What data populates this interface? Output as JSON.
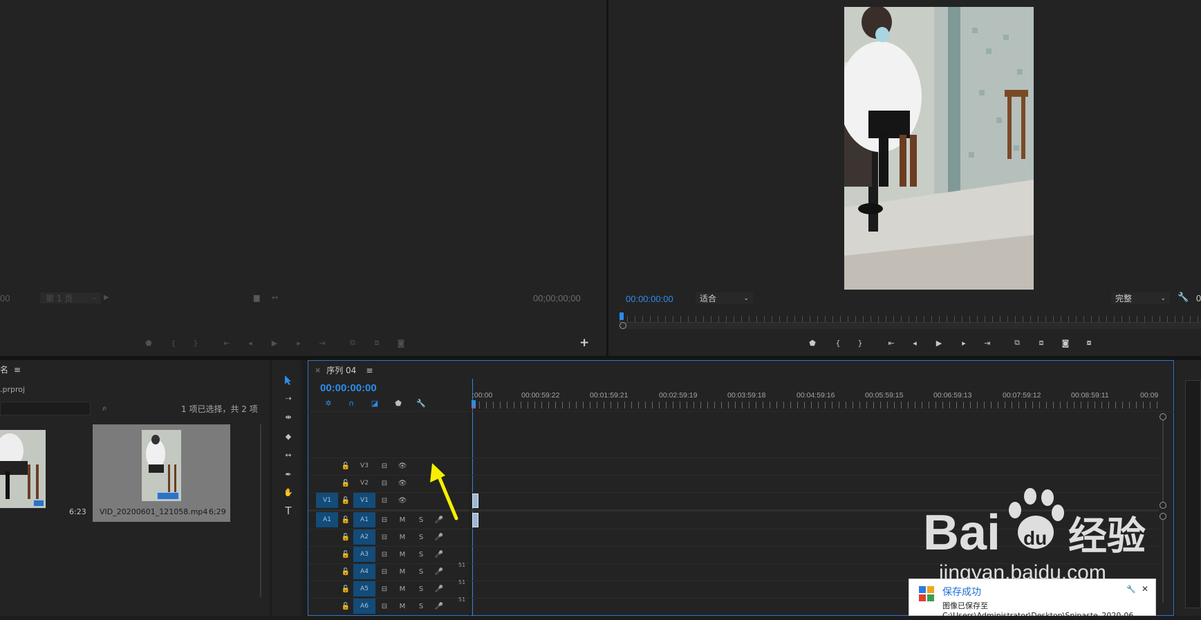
{
  "source_monitor": {
    "timecode_left": "00",
    "page_select": "第 1 页",
    "timecode_right": "00;00;00;00",
    "add_label": "+"
  },
  "program_monitor": {
    "timecode": "00:00:00:00",
    "fit_select": "适合",
    "quality_select": "完整",
    "right_cut": "0"
  },
  "project_panel": {
    "tab_fragment": "名",
    "tab_menu": "≡",
    "project_file": ".prproj",
    "selection_status": "1 项已选择，共 2 项",
    "items": [
      {
        "name": "",
        "duration": "6:23"
      },
      {
        "name": "VID_20200601_121058.mp4",
        "duration": "6;29"
      }
    ]
  },
  "timeline": {
    "close": "×",
    "sequence_tab": "序列 04",
    "menu": "≡",
    "timecode": "00:00:00:00",
    "ruler": [
      ":00:00",
      "00:00:59:22",
      "00:01:59:21",
      "00:02:59:19",
      "00:03:59:18",
      "00:04:59:16",
      "00:05:59:15",
      "00:06:59:13",
      "00:07:59:12",
      "00:08:59:11",
      "00:09"
    ],
    "video_tracks": [
      {
        "target": "",
        "name": "V3"
      },
      {
        "target": "",
        "name": "V2"
      },
      {
        "target": "V1",
        "name": "V1"
      }
    ],
    "audio_tracks": [
      {
        "target": "A1",
        "name": "A1",
        "m": "M",
        "s": "S",
        "extra": ""
      },
      {
        "target": "",
        "name": "A2",
        "m": "M",
        "s": "S",
        "extra": ""
      },
      {
        "target": "",
        "name": "A3",
        "m": "M",
        "s": "S",
        "extra": ""
      },
      {
        "target": "",
        "name": "A4",
        "m": "M",
        "s": "S",
        "extra": "51"
      },
      {
        "target": "",
        "name": "A5",
        "m": "M",
        "s": "S",
        "extra": "51"
      },
      {
        "target": "",
        "name": "A6",
        "m": "M",
        "s": "S",
        "extra": "51"
      }
    ]
  },
  "toast": {
    "title": "保存成功",
    "line1": "图像已保存至",
    "line2": "C:\\Users\\Administrator\\Desktop\\Snipaste_2020-06",
    "close": "✕"
  },
  "watermark": {
    "brand": "Bai du 经验",
    "url": "jingyan.baidu.com"
  },
  "colors": {
    "accent": "#2d8ceb",
    "target_blue": "#134b79",
    "arrow": "#f6f000",
    "playhead_red": "#e33b3b"
  }
}
